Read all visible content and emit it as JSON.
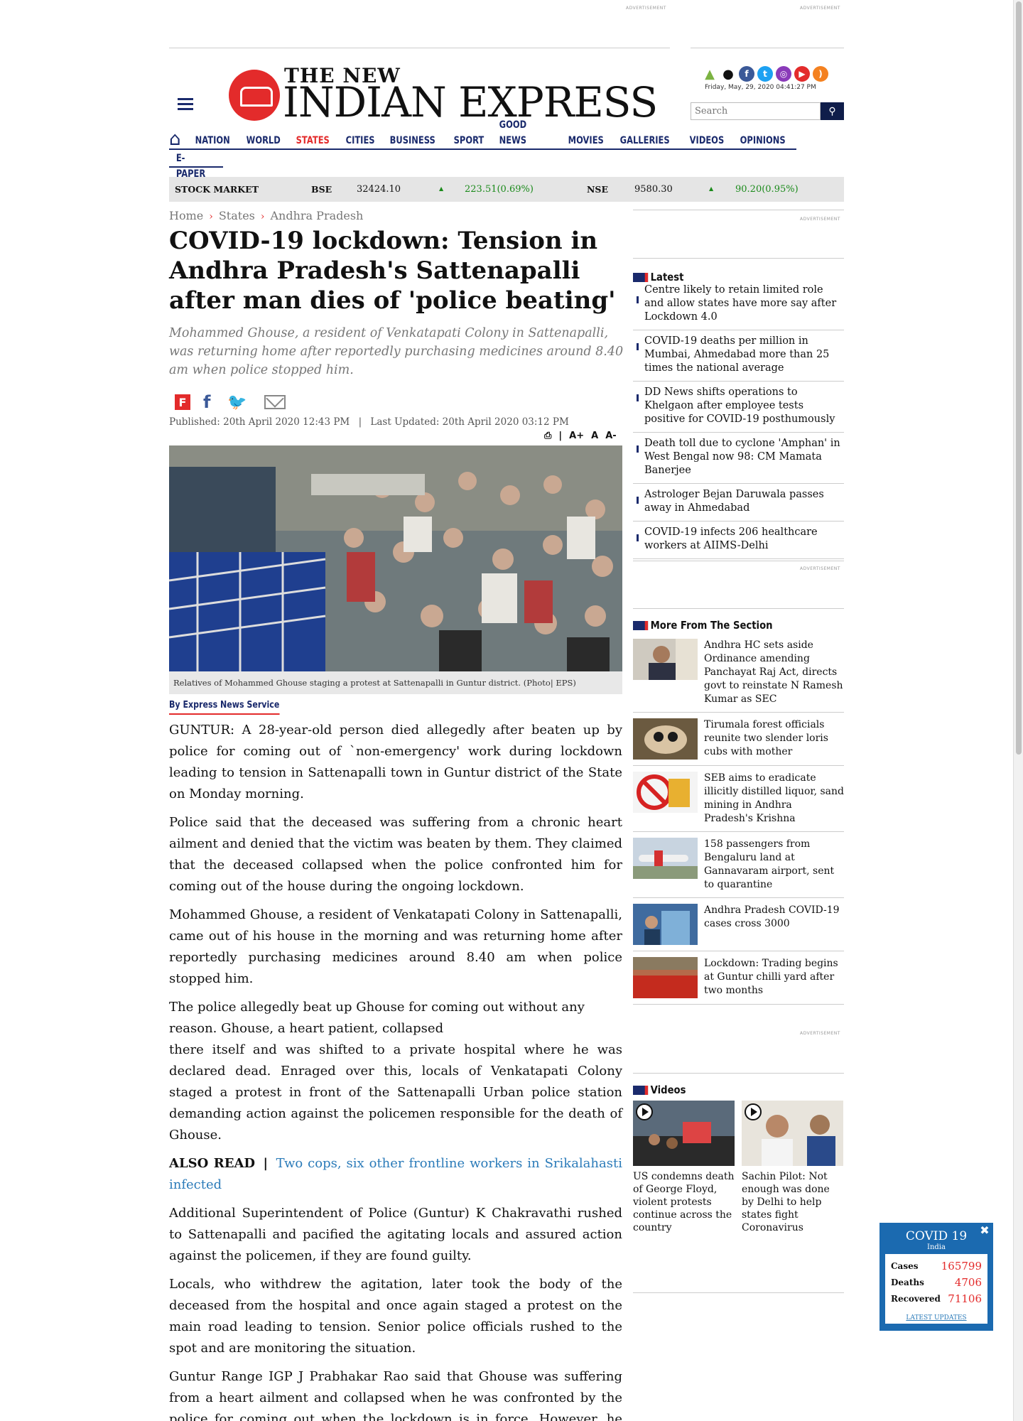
{
  "ads": {
    "label": "ADVERTISEMENT"
  },
  "header": {
    "logo_top": "THE NEW",
    "logo_main": "INDIAN EXPRESS",
    "date": "Friday, May, 29, 2020  04:41:27 PM",
    "search_placeholder": "Search",
    "social_icons": [
      "android-icon",
      "apple-icon",
      "facebook-icon",
      "twitter-icon",
      "instagram-icon",
      "youtube-icon",
      "rss-icon"
    ]
  },
  "nav": {
    "items": [
      "NATION",
      "WORLD",
      "STATES",
      "CITIES",
      "BUSINESS",
      "SPORT",
      "GOOD NEWS",
      "MOVIES",
      "GALLERIES",
      "VIDEOS",
      "OPINIONS"
    ],
    "active": "STATES",
    "second_row": "E-PAPER"
  },
  "stock": {
    "label": "STOCK MARKET",
    "bse_label": "BSE",
    "bse_value": "32424.10",
    "bse_change": "223.51(0.69%)",
    "nse_label": "NSE",
    "nse_value": "9580.30",
    "nse_change": "90.20(0.95%)"
  },
  "breadcrumb": [
    "Home",
    "States",
    "Andhra Pradesh"
  ],
  "article": {
    "headline": "COVID-19 lockdown: Tension in Andhra Pradesh's Sattenapalli after man dies of 'police beating'",
    "summary": "Mohammed Ghouse, a resident of Venkatapati Colony in Sattenapalli, was returning home after reportedly purchasing medicines around 8.40 am when police stopped him.",
    "published": "Published: 20th April 2020 12:43 PM",
    "updated": "Last Updated: 20th April 2020 03:12 PM",
    "divider": "|",
    "font_tools": [
      "A+",
      "A",
      "A-"
    ],
    "caption": "Relatives of Mohammed Ghouse staging a protest at Sattenapalli in Guntur district. (Photo| EPS)",
    "byline": "By Express News Service",
    "paragraphs": [
      "GUNTUR: A 28-year-old person died allegedly after beaten up by police for coming out of `non-emergency' work during lockdown leading to tension in Sattenapalli town in Guntur district of the State on Monday morning.",
      "Police said that the deceased was suffering from a chronic heart ailment and denied that the victim was beaten by them. They claimed that the deceased collapsed when the police confronted him for coming out of the house during the ongoing lockdown.",
      "Mohammed Ghouse, a resident of Venkatapati Colony in Sattenapalli, came out of his house in the morning and was returning home after reportedly purchasing medicines around 8.40 am when police stopped him.",
      "The police allegedly beat up Ghouse for coming out without any reason. Ghouse, a heart patient, collapsed",
      "there itself and was shifted to a private hospital where he was declared dead. Enraged over this, locals of Venkatapati Colony staged a protest in front of the Sattenapalli Urban police station demanding action against the policemen responsible for the death of Ghouse.",
      "Additional Superintendent of Police (Guntur)  K Chakravathi rushed to Sattenapalli and pacified the agitating locals and assured action against the policemen, if they are found guilty.",
      "Locals, who withdrew the agitation, later took the body of the deceased from the hospital and once again staged a protest on the main road leading to tension. Senior police officials rushed to the spot and are monitoring the situation.",
      "Guntur Range IGP J Prabhakar Rao said that Ghouse was suffering from a heart ailment and collapsed when he was confronted by the police for coming out when the lockdown is in force. However, he added that a departmental inquiry will be conducted and if any policeman was"
    ],
    "also_read_label": "ALSO READ",
    "also_read_sep": "|",
    "also_read_link": "Two cops, six other frontline workers in Srikalahasti infected"
  },
  "sidebar": {
    "latest_title": "Latest",
    "latest": [
      "Centre likely to retain limited role and allow states have more say after Lockdown 4.0",
      "COVID-19 deaths per million in Mumbai, Ahmedabad more than 25 times the national average",
      "DD News shifts operations to Khelgaon after employee tests positive for COVID-19 posthumously",
      "Death toll due to cyclone 'Amphan' in West Bengal now 98: CM Mamata Banerjee",
      "Astrologer Bejan Daruwala passes away in Ahmedabad",
      "COVID-19 infects 206 healthcare workers at AIIMS-Delhi"
    ],
    "more_title": "More From The Section",
    "more": [
      "Andhra HC sets aside Ordinance amending Panchayat Raj Act, directs govt to reinstate N Ramesh Kumar as SEC",
      "Tirumala forest officials reunite two slender loris cubs with mother",
      "SEB aims to eradicate illicitly distilled liquor, sand mining in Andhra Pradesh's Krishna",
      "158 passengers from Bengaluru land at Gannavaram airport, sent to quarantine",
      "Andhra Pradesh COVID-19 cases cross 3000",
      "Lockdown: Trading begins at Guntur chilli yard after two months"
    ],
    "videos_title": "Videos",
    "videos": [
      "US condemns death of George Floyd, violent protests continue across the country",
      "Sachin Pilot: Not enough was done by Delhi to help states fight Coronavirus"
    ]
  },
  "covid": {
    "title": "COVID 19",
    "region": "India",
    "cases_label": "Cases",
    "cases": "165799",
    "deaths_label": "Deaths",
    "deaths": "4706",
    "recovered_label": "Recovered",
    "recovered": "71106",
    "link": "LATEST UPDATES"
  }
}
